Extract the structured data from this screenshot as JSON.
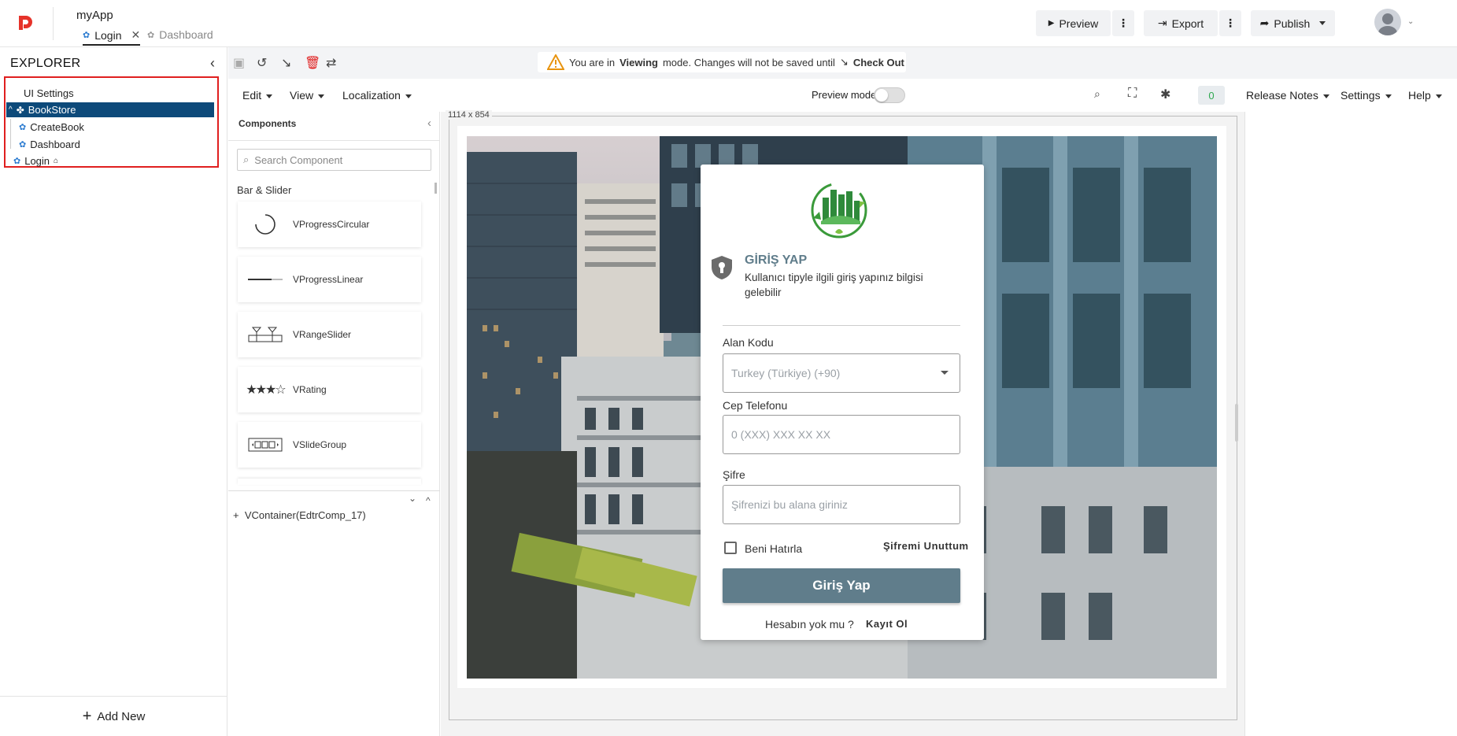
{
  "app": {
    "name": "myApp"
  },
  "tabs": [
    {
      "label": "Login"
    },
    {
      "label": "Dashboard"
    }
  ],
  "header": {
    "preview": "Preview",
    "export": "Export",
    "publish": "Publish"
  },
  "explorer": {
    "title": "EXPLORER",
    "items": [
      "UI Settings",
      "BookStore",
      "CreateBook",
      "Dashboard",
      "Login"
    ],
    "add_new": "Add New"
  },
  "notice": {
    "prefix": "You are in",
    "mode": "Viewing",
    "suffix": "mode. Changes will not be saved until",
    "action": "Check Out"
  },
  "menus": {
    "edit": "Edit",
    "view": "View",
    "localization": "Localization",
    "preview_mode": "Preview mode",
    "count": "0",
    "release_notes": "Release Notes",
    "settings": "Settings",
    "help": "Help"
  },
  "components": {
    "title": "Components",
    "search_placeholder": "Search Component",
    "group": "Bar & Slider",
    "items": [
      "VProgressCircular",
      "VProgressLinear",
      "VRangeSlider",
      "VRating",
      "VSlideGroup"
    ],
    "container": "VContainer(EdtrComp_17)"
  },
  "canvas": {
    "size": "1114 x 854"
  },
  "login": {
    "title": "GİRİŞ YAP",
    "subtitle": "Kullanıcı tipyle ilgili giriş yapınız bilgisi gelebilir",
    "area_code_label": "Alan Kodu",
    "area_code_value": "Turkey (Türkiye) (+90)",
    "phone_label": "Cep Telefonu",
    "phone_placeholder": "0 (XXX) XXX XX XX",
    "password_label": "Şifre",
    "password_placeholder": "Şifrenizi bu alana giriniz",
    "remember": "Beni Hatırla",
    "forgot": "Şifremi Unuttum",
    "submit": "Giriş Yap",
    "no_account": "Hesabın yok mu ?",
    "register": "Kayıt Ol"
  },
  "colors": {
    "accent": "#0d4a7a",
    "button": "#607d8b",
    "highlight": "#e01f1f",
    "logo": "#e6332a"
  }
}
